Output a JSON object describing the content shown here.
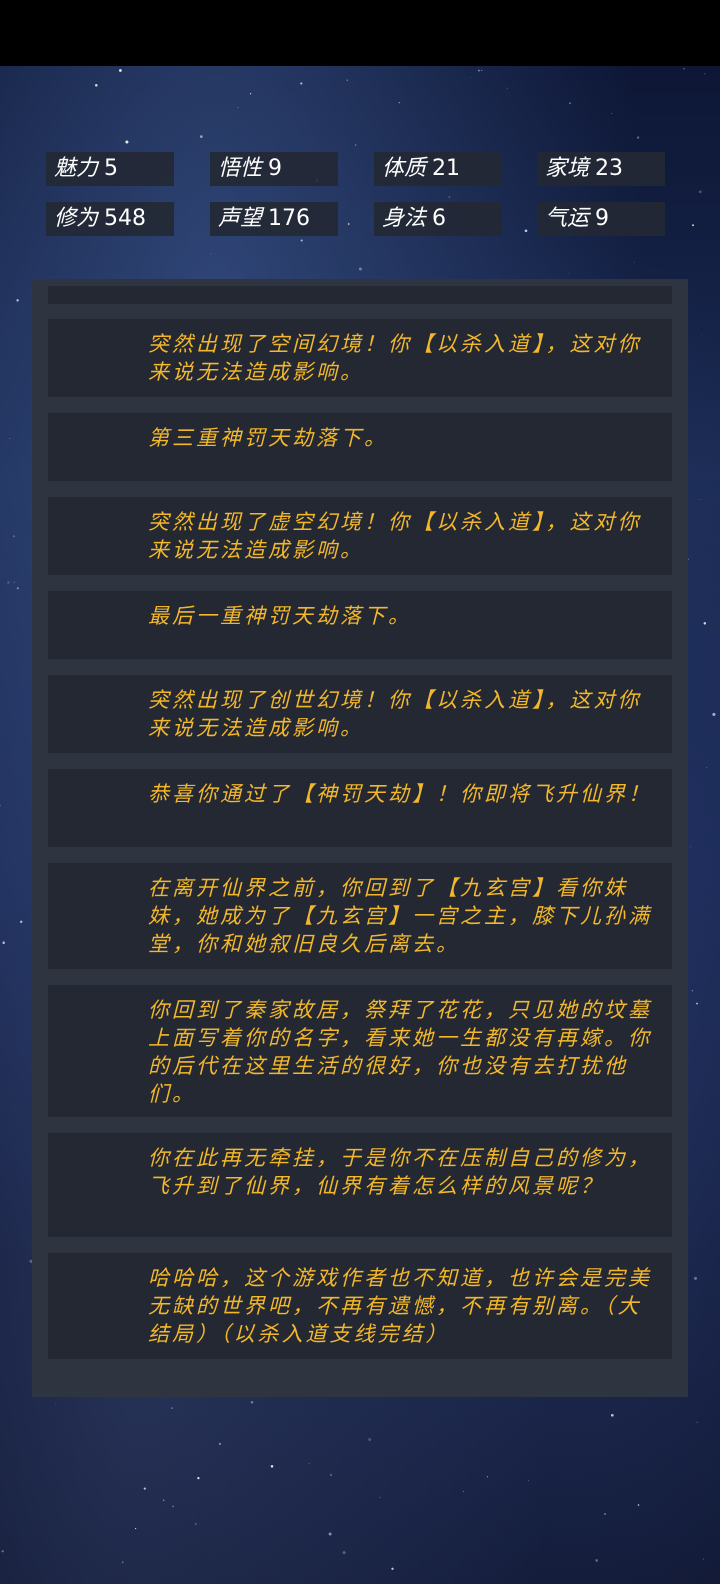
{
  "stats": [
    {
      "label": "魅力",
      "value": "5"
    },
    {
      "label": "悟性",
      "value": "9"
    },
    {
      "label": "体质",
      "value": "21"
    },
    {
      "label": "家境",
      "value": "23"
    },
    {
      "label": "修为",
      "value": "548"
    },
    {
      "label": "声望",
      "value": "176"
    },
    {
      "label": "身法",
      "value": "6"
    },
    {
      "label": "气运",
      "value": "9"
    }
  ],
  "log": [
    "",
    "突然出现了空间幻境！你【以杀入道】，这对你来说无法造成影响。",
    "第三重神罚天劫落下。",
    "突然出现了虚空幻境！你【以杀入道】，这对你来说无法造成影响。",
    "最后一重神罚天劫落下。",
    "突然出现了创世幻境！你【以杀入道】，这对你来说无法造成影响。",
    "恭喜你通过了【神罚天劫】！你即将飞升仙界！",
    "在离开仙界之前，你回到了【九玄宫】看你妹妹，她成为了【九玄宫】一宫之主，膝下儿孙满堂，你和她叙旧良久后离去。",
    "你回到了秦家故居，祭拜了花花，只见她的坟墓上面写着你的名字，看来她一生都没有再嫁。你的后代在这里生活的很好，你也没有去打扰他们。",
    "你在此再无牵挂，于是你不在压制自己的修为，飞升到了仙界，仙界有着怎么样的风景呢？",
    "哈哈哈，这个游戏作者也不知道，也许会是完美无缺的世界吧，不再有遗憾，不再有别离。（大结局）（以杀入道支线完结）"
  ]
}
